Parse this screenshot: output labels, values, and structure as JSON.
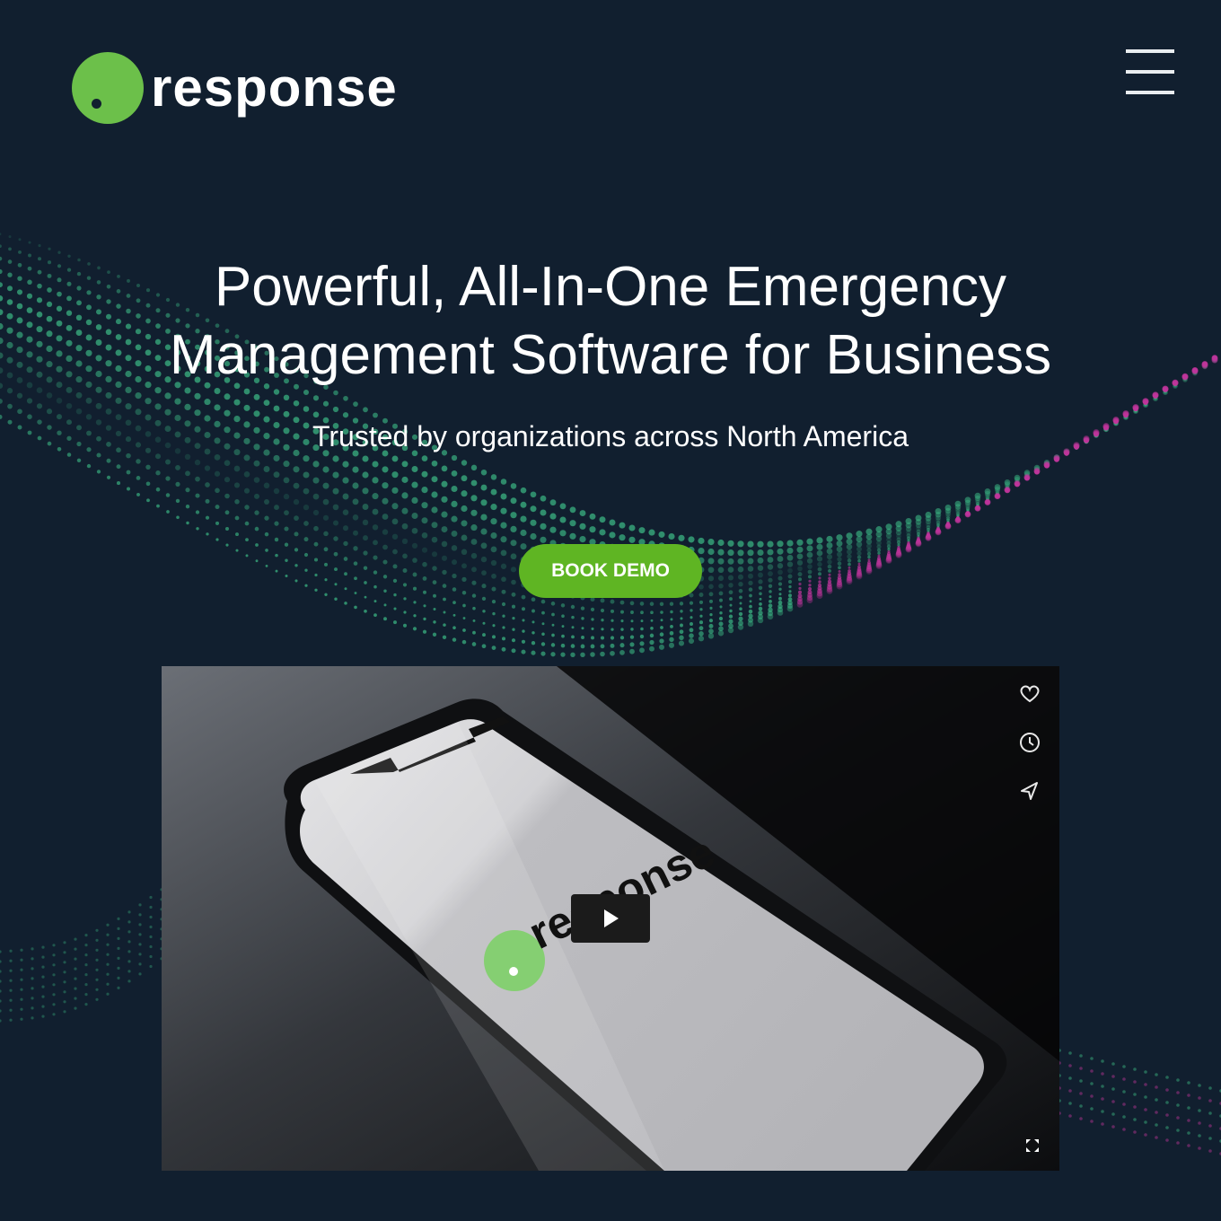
{
  "brand": {
    "name": "response",
    "accent_color": "#6cc04a"
  },
  "header": {
    "menu_icon": "hamburger-menu-icon"
  },
  "hero": {
    "title_line1": "Powerful, All-In-One Emergency",
    "title_line2": "Management Software for Business",
    "subtitle": "Trusted by organizations across North America",
    "cta_label": "BOOK DEMO"
  },
  "video": {
    "phone_logo_text": "response",
    "icons": [
      "heart-icon",
      "clock-icon",
      "share-icon",
      "play-icon",
      "fullscreen-icon"
    ]
  },
  "colors": {
    "background": "#111f2f",
    "button": "#5fb523",
    "wave_green": "#3dbe88",
    "wave_magenta": "#c0359c"
  }
}
